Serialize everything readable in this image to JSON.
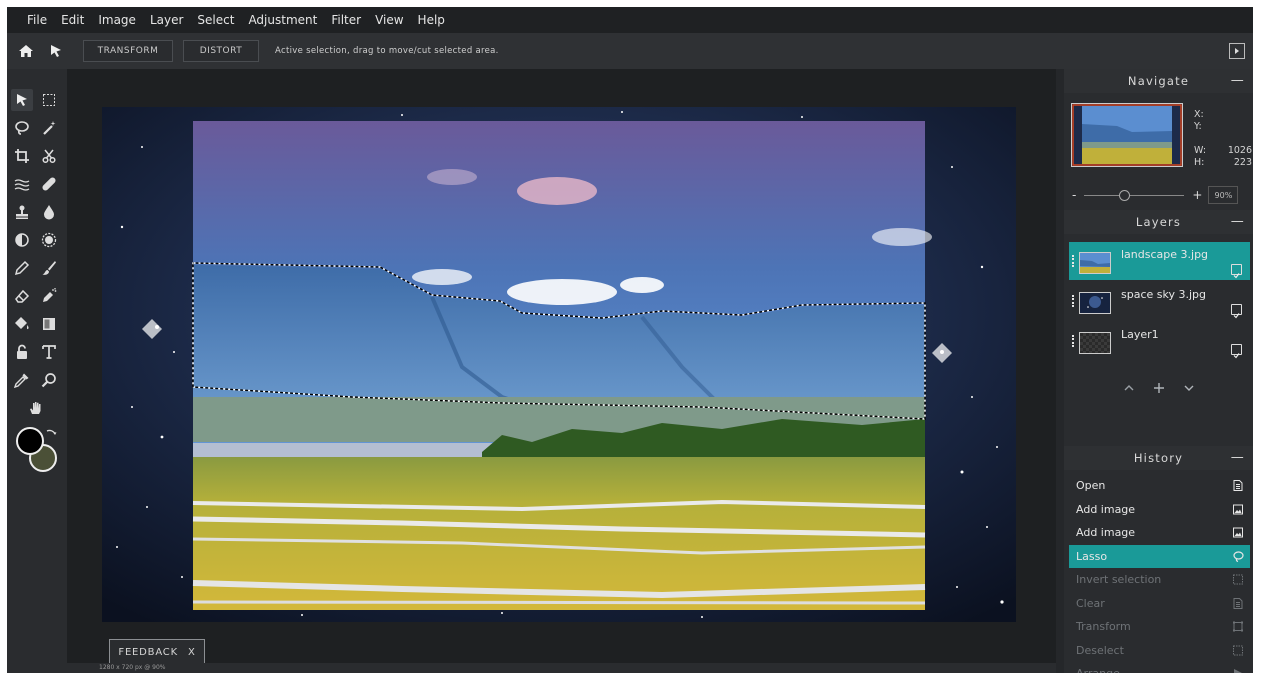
{
  "menu": [
    "File",
    "Edit",
    "Image",
    "Layer",
    "Select",
    "Adjustment",
    "Filter",
    "View",
    "Help"
  ],
  "toolbar": {
    "transform_label": "TRANSFORM",
    "distort_label": "DISTORT",
    "hint": "Active selection, drag to move/cut selected area."
  },
  "tools": [
    "pointer-icon",
    "marquee-icon",
    "lasso-icon",
    "magic-wand-icon",
    "crop-icon",
    "scissors-icon",
    "smudge-icon",
    "bandage-icon",
    "stamp-icon",
    "drop-icon",
    "dodge-icon",
    "burn-icon",
    "pen-icon",
    "brush-icon",
    "eraser-icon",
    "spray-icon",
    "bucket-icon",
    "gradient-icon",
    "lock-icon",
    "text-icon",
    "eyedropper-icon",
    "zoom-icon",
    "hand-icon"
  ],
  "colors": {
    "foreground": "#000000",
    "background": "#4b5037",
    "accent": "#1a9a98",
    "app_bg": "#2a2c2f"
  },
  "navigate": {
    "title": "Navigate",
    "x_label": "X:",
    "x_value": "",
    "y_label": "Y:",
    "y_value": "",
    "w_label": "W:",
    "w_value": "1026",
    "h_label": "H:",
    "h_value": "223",
    "zoom_minus": "-",
    "zoom_plus": "+",
    "zoom_value": "90%",
    "zoom_level_fraction": 0.4
  },
  "layers": {
    "title": "Layers",
    "items": [
      {
        "name": "landscape 3.jpg",
        "selected": true
      },
      {
        "name": "space sky 3.jpg",
        "selected": false
      },
      {
        "name": "Layer1",
        "selected": false
      }
    ]
  },
  "history": {
    "title": "History",
    "items": [
      {
        "label": "Open",
        "icon": "document-icon",
        "state": "normal"
      },
      {
        "label": "Add image",
        "icon": "image-icon",
        "state": "normal"
      },
      {
        "label": "Add image",
        "icon": "image-icon",
        "state": "normal"
      },
      {
        "label": "Lasso",
        "icon": "lasso-icon",
        "state": "selected"
      },
      {
        "label": "Invert selection",
        "icon": "marquee-icon",
        "state": "dim"
      },
      {
        "label": "Clear",
        "icon": "document-icon",
        "state": "dim"
      },
      {
        "label": "Transform",
        "icon": "transform-icon",
        "state": "dim"
      },
      {
        "label": "Deselect",
        "icon": "marquee-icon",
        "state": "dim"
      },
      {
        "label": "Arrange",
        "icon": "pointer-icon",
        "state": "dim"
      }
    ]
  },
  "feedback": {
    "label": "FEEDBACK",
    "close": "X"
  },
  "status": {
    "text": "1280 x 720 px @ 90%"
  }
}
